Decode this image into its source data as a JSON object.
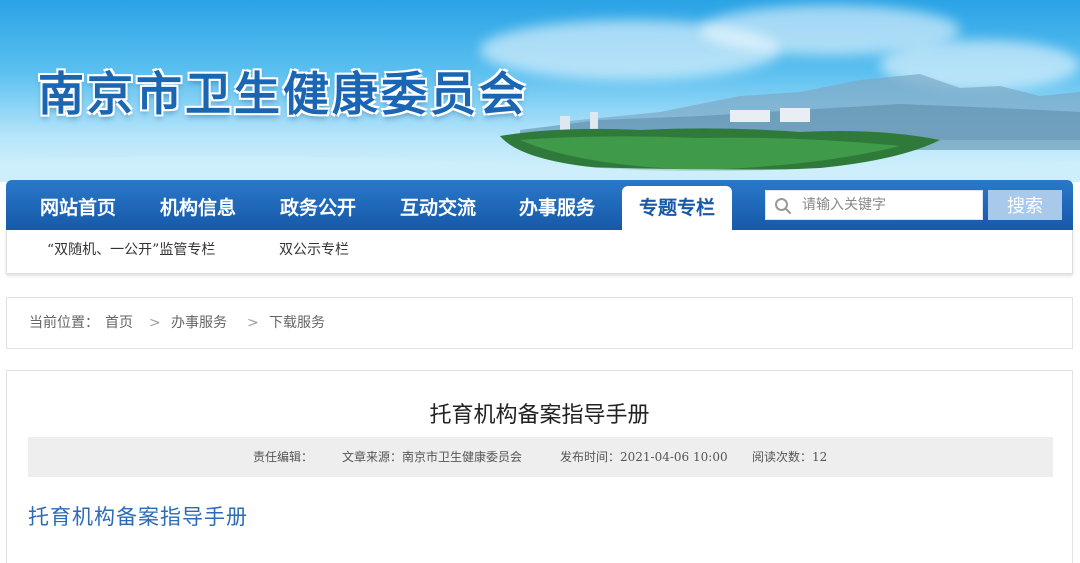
{
  "banner": {
    "site_title": "南京市卫生健康委员会"
  },
  "nav": {
    "items": [
      {
        "label": "网站首页",
        "active": false
      },
      {
        "label": "机构信息",
        "active": false
      },
      {
        "label": "政务公开",
        "active": false
      },
      {
        "label": "互动交流",
        "active": false
      },
      {
        "label": "办事服务",
        "active": false
      },
      {
        "label": "专题专栏",
        "active": true
      }
    ],
    "search": {
      "placeholder": "请输入关键字",
      "button_label": "搜索"
    }
  },
  "subnav": {
    "items": [
      "“双随机、一公开”监管专栏",
      "双公示专栏"
    ]
  },
  "breadcrumb": {
    "prefix": "当前位置：",
    "items": [
      "首页",
      "办事服务",
      "下载服务"
    ],
    "separator": ">"
  },
  "article": {
    "title": "托育机构备案指导手册",
    "meta": {
      "editor": "责任编辑：",
      "source": "文章来源：南京市卫生健康委员会",
      "publish_time": "发布时间：2021-04-06 10:00",
      "views": "阅读次数：12"
    },
    "body_title": "托育机构备案指导手册"
  },
  "colors": {
    "nav_bg": "#1759a8",
    "accent_blue": "#2d6bb5",
    "search_button": "#a9c9ea"
  }
}
